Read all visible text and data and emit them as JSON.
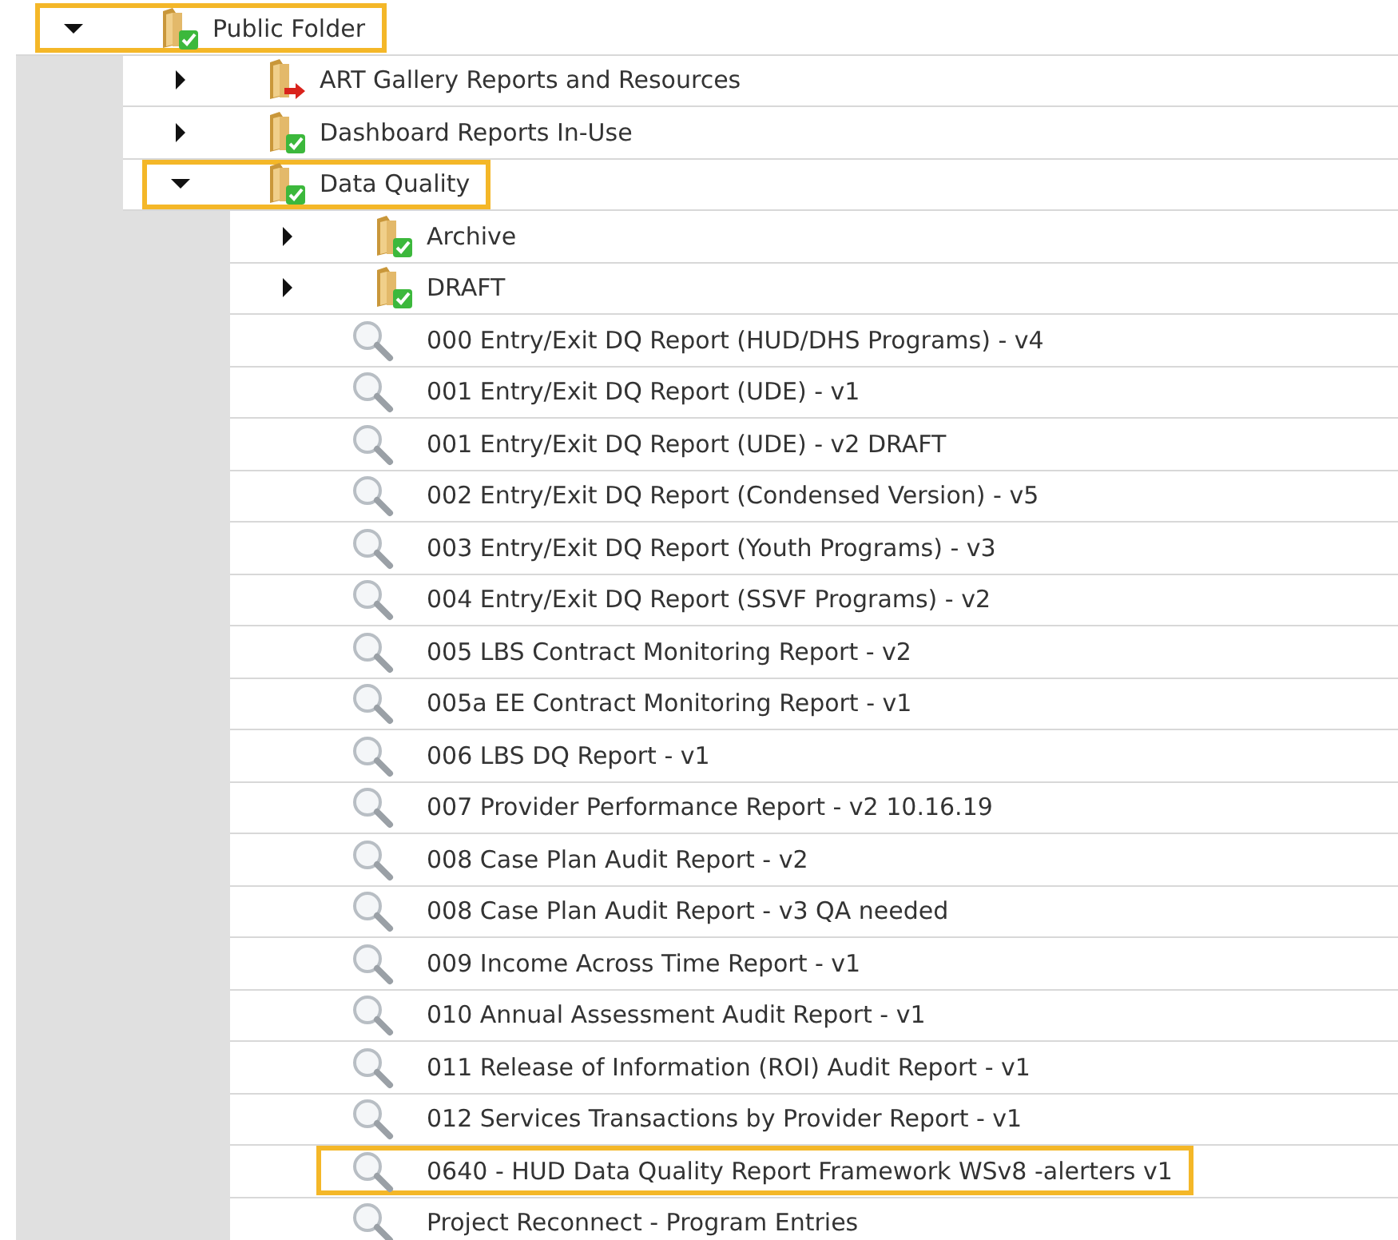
{
  "tree": [
    {
      "kind": "folder",
      "label": "Public Folder",
      "expanded": true,
      "highlighted": true,
      "children": [
        {
          "kind": "link-folder",
          "label": "ART Gallery Reports and Resources",
          "expanded": false,
          "highlighted": false
        },
        {
          "kind": "folder",
          "label": "Dashboard Reports In-Use",
          "expanded": false,
          "highlighted": false
        },
        {
          "kind": "folder",
          "label": "Data Quality",
          "expanded": true,
          "highlighted": true,
          "children": [
            {
              "kind": "folder",
              "label": "Archive",
              "expanded": false,
              "highlighted": false
            },
            {
              "kind": "folder",
              "label": "DRAFT",
              "expanded": false,
              "highlighted": false
            },
            {
              "kind": "report",
              "label": "000 Entry/Exit DQ Report (HUD/DHS Programs) - v4",
              "highlighted": false
            },
            {
              "kind": "report",
              "label": "001 Entry/Exit DQ Report (UDE) - v1",
              "highlighted": false
            },
            {
              "kind": "report",
              "label": "001 Entry/Exit DQ Report (UDE) - v2 DRAFT",
              "highlighted": false
            },
            {
              "kind": "report",
              "label": "002 Entry/Exit DQ Report (Condensed Version) - v5",
              "highlighted": false
            },
            {
              "kind": "report",
              "label": "003 Entry/Exit DQ Report (Youth Programs) - v3",
              "highlighted": false
            },
            {
              "kind": "report",
              "label": "004 Entry/Exit DQ Report (SSVF Programs) - v2",
              "highlighted": false
            },
            {
              "kind": "report",
              "label": "005 LBS Contract Monitoring Report - v2",
              "highlighted": false
            },
            {
              "kind": "report",
              "label": "005a EE Contract Monitoring Report - v1",
              "highlighted": false
            },
            {
              "kind": "report",
              "label": "006 LBS DQ Report - v1",
              "highlighted": false
            },
            {
              "kind": "report",
              "label": "007 Provider Performance Report - v2 10.16.19",
              "highlighted": false
            },
            {
              "kind": "report",
              "label": "008 Case Plan Audit Report - v2",
              "highlighted": false
            },
            {
              "kind": "report",
              "label": "008 Case Plan Audit Report - v3 QA needed",
              "highlighted": false
            },
            {
              "kind": "report",
              "label": "009 Income Across Time Report - v1",
              "highlighted": false
            },
            {
              "kind": "report",
              "label": "010 Annual Assessment Audit Report - v1",
              "highlighted": false
            },
            {
              "kind": "report",
              "label": "011 Release of Information (ROI) Audit Report - v1",
              "highlighted": false
            },
            {
              "kind": "report",
              "label": "012 Services Transactions by Provider Report - v1",
              "highlighted": false
            },
            {
              "kind": "report",
              "label": "0640 - HUD Data Quality Report Framework WSv8 -alerters v1",
              "highlighted": true
            },
            {
              "kind": "report",
              "label": "Project Reconnect - Program Entries",
              "highlighted": false
            }
          ]
        }
      ]
    }
  ]
}
